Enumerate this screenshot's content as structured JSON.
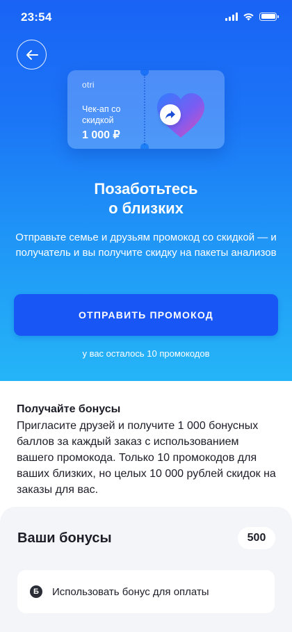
{
  "status_bar": {
    "time": "23:54"
  },
  "promo_card": {
    "brand": "otri",
    "title": "Чек-ап со скидкой",
    "amount": "1 000 ₽"
  },
  "hero": {
    "title": "Позаботьтесь о близких",
    "subtitle": "Отправьте семье и друзьям промокод со скидкой — и получатель и вы получите скидку на пакеты анализов",
    "send_button_label": "ОТПРАВИТЬ ПРОМОКОД",
    "remaining_text": "у вас осталось 10 промокодов"
  },
  "bonus_info": {
    "heading": "Получайте бонусы",
    "text": "Пригласите друзей и получите 1 000 бонусных баллов за каждый заказ с использованием вашего промокода. Только 10 промокодов для ваших близких, но целых 10 000 рублей скидок на заказы для вас."
  },
  "bonus_panel": {
    "title": "Ваши бонусы",
    "count": "500",
    "coin_symbol": "Б",
    "use_label": "Использовать бонус для оплаты"
  },
  "colors": {
    "hero_gradient_top": "#1a63f5",
    "hero_gradient_bottom": "#25b5f7",
    "button": "#1856f5",
    "text_dark": "#1d1d28",
    "panel_bg": "#f4f5f8"
  },
  "icons": [
    "signal-icon",
    "wifi-icon",
    "battery-icon",
    "arrow-left-icon",
    "heart-icon",
    "share-icon",
    "bonus-coin-icon"
  ]
}
